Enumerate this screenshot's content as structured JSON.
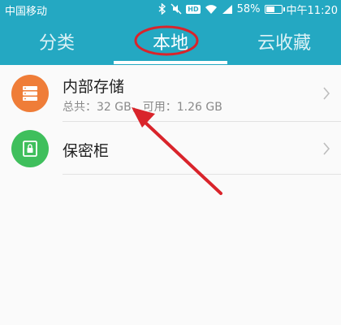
{
  "status_bar": {
    "carrier": "中国移动",
    "hd_badge": "HD",
    "battery": "58%",
    "battery_level": 0.58,
    "time": "中午11:20",
    "icons": [
      "bluetooth-icon",
      "mute-icon",
      "wifi-icon",
      "signal-icon",
      "battery-icon"
    ]
  },
  "tabs": [
    {
      "label": "分类",
      "selected": false
    },
    {
      "label": "本地",
      "selected": true
    },
    {
      "label": "云收藏",
      "selected": false
    }
  ],
  "storage_list": [
    {
      "title": "内部存储",
      "subtitle": "总共：32 GB，可用：1.26 GB",
      "icon": "storage-icon"
    },
    {
      "title": "保密柜",
      "icon": "safe-icon"
    }
  ],
  "annotation": {
    "circle_color": "#d9242b",
    "arrow_color": "#d9242b",
    "target": "本地"
  },
  "colors": {
    "header": "#24a8c2",
    "storage_icon_bg": "#ef7d38",
    "safe_icon_bg": "#3fbf5c"
  }
}
